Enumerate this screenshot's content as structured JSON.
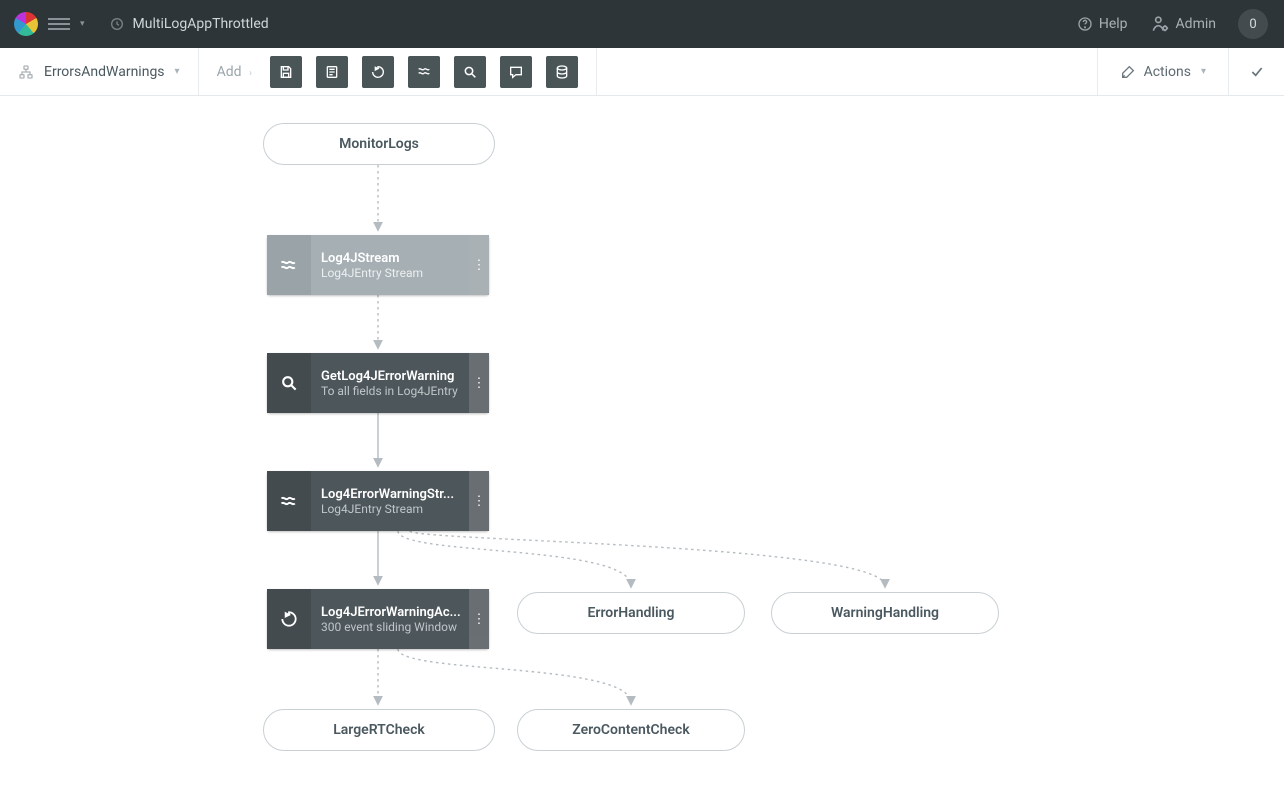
{
  "topbar": {
    "app_name": "MultiLogAppThrottled",
    "help_label": "Help",
    "admin_label": "Admin",
    "badge_count": "0"
  },
  "toolbar": {
    "workflow_name": "ErrorsAndWarnings",
    "add_label": "Add",
    "actions_label": "Actions",
    "buttons": [
      {
        "name": "save-icon"
      },
      {
        "name": "source-icon"
      },
      {
        "name": "replay-icon"
      },
      {
        "name": "stream-icon"
      },
      {
        "name": "search-icon"
      },
      {
        "name": "comment-icon"
      },
      {
        "name": "lineage-icon"
      }
    ]
  },
  "nodes": {
    "monitor": {
      "label": "MonitorLogs"
    },
    "log4jstream": {
      "title": "Log4JStream",
      "sub": "Log4JEntry Stream"
    },
    "getwarn": {
      "title": "GetLog4JErrorWarning",
      "sub": "To all fields in Log4JEntry"
    },
    "ewstream": {
      "title": "Log4ErrorWarningStr...",
      "sub": "Log4JEntry Stream"
    },
    "ewactivity": {
      "title": "Log4JErrorWarningAc...",
      "sub": "300 event sliding Window"
    },
    "errorh": {
      "label": "ErrorHandling"
    },
    "warnh": {
      "label": "WarningHandling"
    },
    "largert": {
      "label": "LargeRTCheck"
    },
    "zerocheck": {
      "label": "ZeroContentCheck"
    }
  }
}
